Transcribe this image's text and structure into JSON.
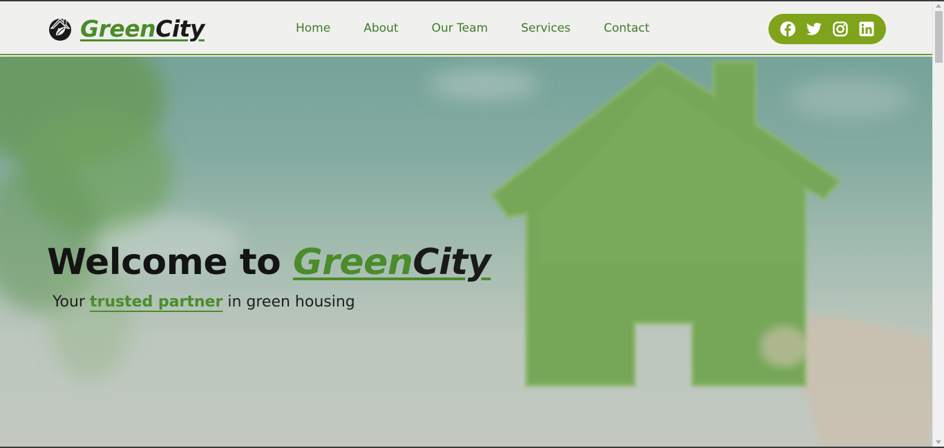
{
  "brand": {
    "name_part1": "Green",
    "name_part2": "City",
    "logo_icon": "house-leaf-logo-icon"
  },
  "nav": {
    "items": [
      {
        "label": "Home"
      },
      {
        "label": "About"
      },
      {
        "label": "Our Team"
      },
      {
        "label": "Services"
      },
      {
        "label": "Contact"
      }
    ]
  },
  "social": {
    "icons": [
      "facebook-icon",
      "twitter-icon",
      "instagram-icon",
      "linkedin-icon"
    ]
  },
  "hero": {
    "title_prefix": "Welcome to ",
    "brand_part1": "Green",
    "brand_part2": "City",
    "subtitle_prefix": "Your ",
    "subtitle_highlight": "trusted partner",
    "subtitle_suffix": " in green housing"
  },
  "colors": {
    "brand_green": "#4a8c2a",
    "nav_text": "#3f7a2a",
    "social_bg": "#7fa31a",
    "header_bg": "#f0f0ee"
  }
}
